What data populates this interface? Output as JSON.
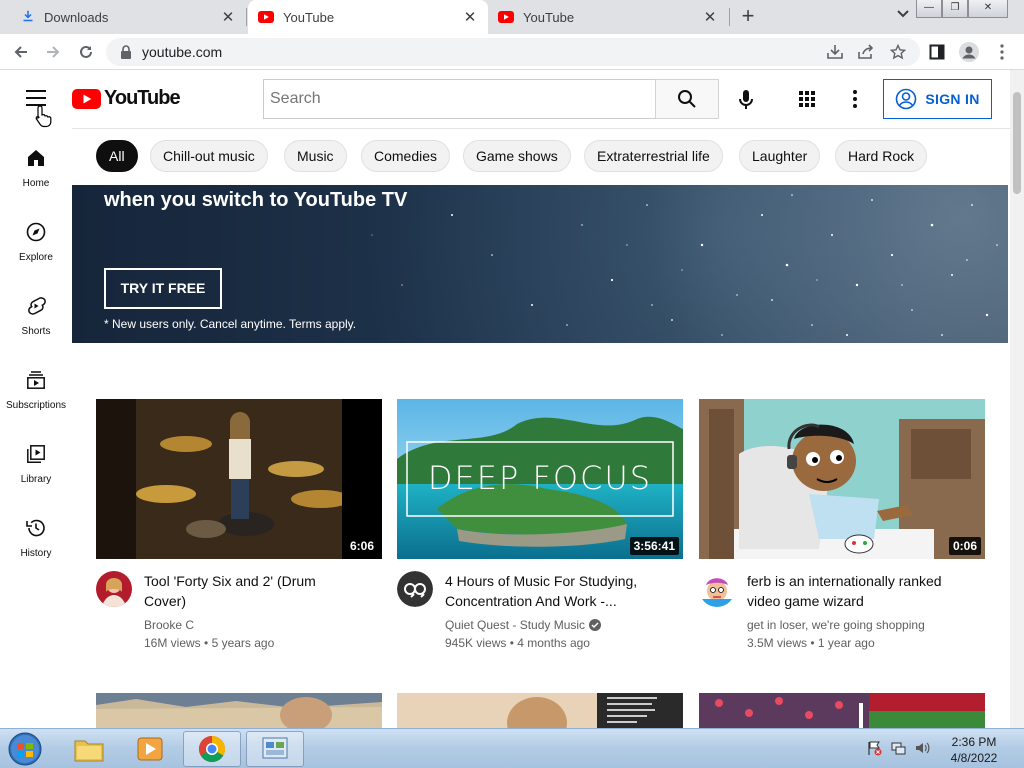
{
  "browser": {
    "tabs": [
      {
        "title": "Downloads",
        "icon": "download-icon"
      },
      {
        "title": "YouTube",
        "icon": "youtube-favicon-icon"
      },
      {
        "title": "YouTube",
        "icon": "youtube-favicon-icon"
      }
    ],
    "active_tab": 1,
    "url": "youtube.com"
  },
  "masthead": {
    "logo_text": "YouTube",
    "search_placeholder": "Search",
    "sign_in_label": "SIGN IN"
  },
  "rail": [
    {
      "label": "Home",
      "icon": "home-icon"
    },
    {
      "label": "Explore",
      "icon": "compass-icon"
    },
    {
      "label": "Shorts",
      "icon": "shorts-icon"
    },
    {
      "label": "Subscriptions",
      "icon": "subscriptions-icon"
    },
    {
      "label": "Library",
      "icon": "library-icon"
    },
    {
      "label": "History",
      "icon": "history-icon"
    }
  ],
  "chips": [
    "All",
    "Chill-out music",
    "Music",
    "Comedies",
    "Game shows",
    "Extraterrestrial life",
    "Laughter",
    "Hard Rock"
  ],
  "selected_chip": "All",
  "banner": {
    "headline": "when you switch to YouTube TV",
    "button": "TRY IT FREE",
    "fine_print": "* New users only. Cancel anytime. Terms apply."
  },
  "videos": [
    {
      "title": "Tool 'Forty Six and 2' (Drum Cover)",
      "title_line1": "Tool 'Forty Six and 2' (Drum",
      "title_line2": "Cover)",
      "channel": "Brooke C",
      "verified": false,
      "views": "16M views",
      "age": "5 years ago",
      "duration": "6:06"
    },
    {
      "title": "4 Hours of Music For Studying, Concentration And Work -...",
      "title_line1": "4 Hours of Music For Studying,",
      "title_line2": "Concentration And Work -...",
      "thumb_text": "DEEP FOCUS",
      "channel": "Quiet Quest - Study Music",
      "verified": true,
      "views": "945K views",
      "age": "4 months ago",
      "duration": "3:56:41"
    },
    {
      "title": "ferb is an internationally ranked video game wizard",
      "title_line1": "ferb is an internationally ranked",
      "title_line2": "video game wizard",
      "channel": "get in loser, we're going shopping",
      "verified": false,
      "views": "3.5M views",
      "age": "1 year ago",
      "duration": "0:06"
    }
  ],
  "taskbar": {
    "time": "2:36 PM",
    "date": "4/8/2022"
  },
  "colors": {
    "youtube_red": "#ff0000",
    "link_blue": "#065fd4",
    "chip_bg": "#f2f2f2"
  }
}
